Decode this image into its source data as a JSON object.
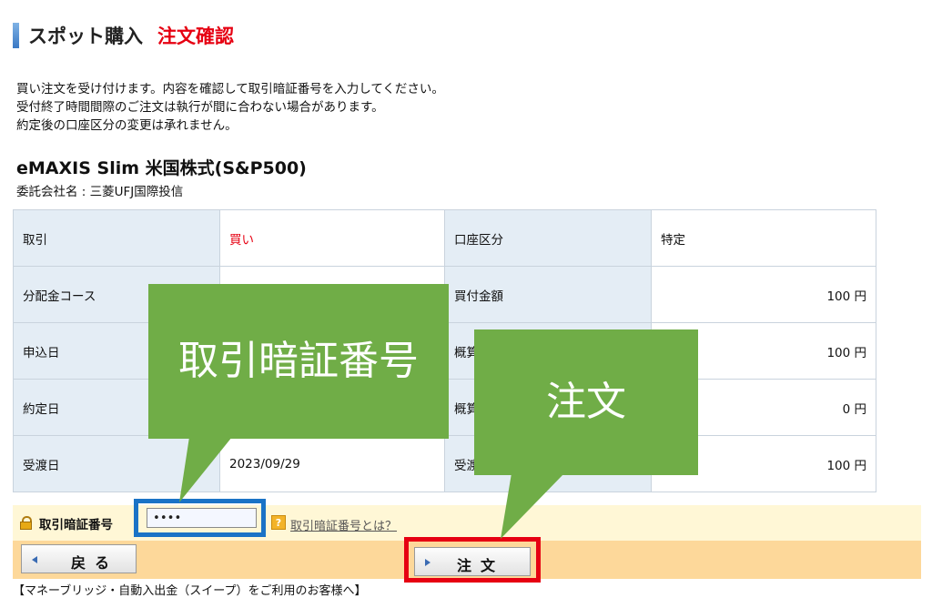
{
  "header": {
    "title": "スポット購入",
    "subtitle": "注文確認"
  },
  "notice": {
    "lines": [
      "買い注文を受け付けます。内容を確認して取引暗証番号を入力してください。",
      "受付終了時間間際のご注文は執行が間に合わない場合があります。",
      "約定後の口座区分の変更は承れません。"
    ]
  },
  "fund": {
    "name": "eMAXIS Slim 米国株式(S&P500)",
    "company": "委託会社名 : 三菱UFJ国際投信"
  },
  "table": {
    "rows": [
      {
        "l1": "取引",
        "v1": "買い",
        "l2": "口座区分",
        "v2": "特定"
      },
      {
        "l1": "分配金コース",
        "v1": "",
        "l2": "買付金額",
        "v2": "100 円"
      },
      {
        "l1": "申込日",
        "v1": "",
        "l2": "概算",
        "v2": "100 円"
      },
      {
        "l1": "約定日",
        "v1": "",
        "l2": "概算",
        "v2": "0 円"
      },
      {
        "l1": "受渡日",
        "v1": "2023/09/29",
        "l2": "受渡",
        "v2": "100 円"
      }
    ]
  },
  "pin": {
    "label": "取引暗証番号",
    "value": "••••",
    "help_icon": "question-icon",
    "help_text": "取引暗証番号とは？"
  },
  "buttons": {
    "back": "戻る",
    "order": "注文"
  },
  "footer": {
    "link": "【マネーブリッジ・自動入出金（スイープ）をご利用のお客様へ】"
  },
  "callouts": {
    "pin": "取引暗証番号",
    "order": "注文"
  },
  "colors": {
    "accent_red": "#e60012",
    "callout_green": "#70ad47",
    "highlight_blue": "#1a73c6",
    "button_bar": "#fdd89a"
  }
}
